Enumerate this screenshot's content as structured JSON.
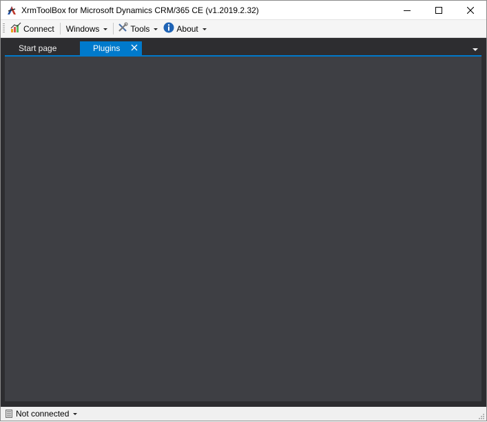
{
  "window": {
    "title": "XrmToolBox for Microsoft Dynamics CRM/365 CE (v1.2019.2.32)",
    "icon": "xrmtoolbox-logo-icon",
    "controls": [
      "minimize-icon",
      "maximize-icon",
      "close-icon"
    ]
  },
  "toolbar": {
    "connect_label": "Connect",
    "connect_icon": "connection-chart-icon",
    "windows_label": "Windows",
    "tools_label": "Tools",
    "tools_icon": "wrench-screwdriver-icon",
    "about_label": "About",
    "about_icon": "info-icon"
  },
  "tabs": [
    {
      "label": "Start page",
      "active": false
    },
    {
      "label": "Plugins",
      "active": true,
      "closable": true
    }
  ],
  "status": {
    "connection_text": "Not connected",
    "connection_icon": "server-icon"
  },
  "colors": {
    "accent": "#007acc",
    "workspace_bg": "#2d2d30",
    "content_bg": "#3e3f44"
  }
}
